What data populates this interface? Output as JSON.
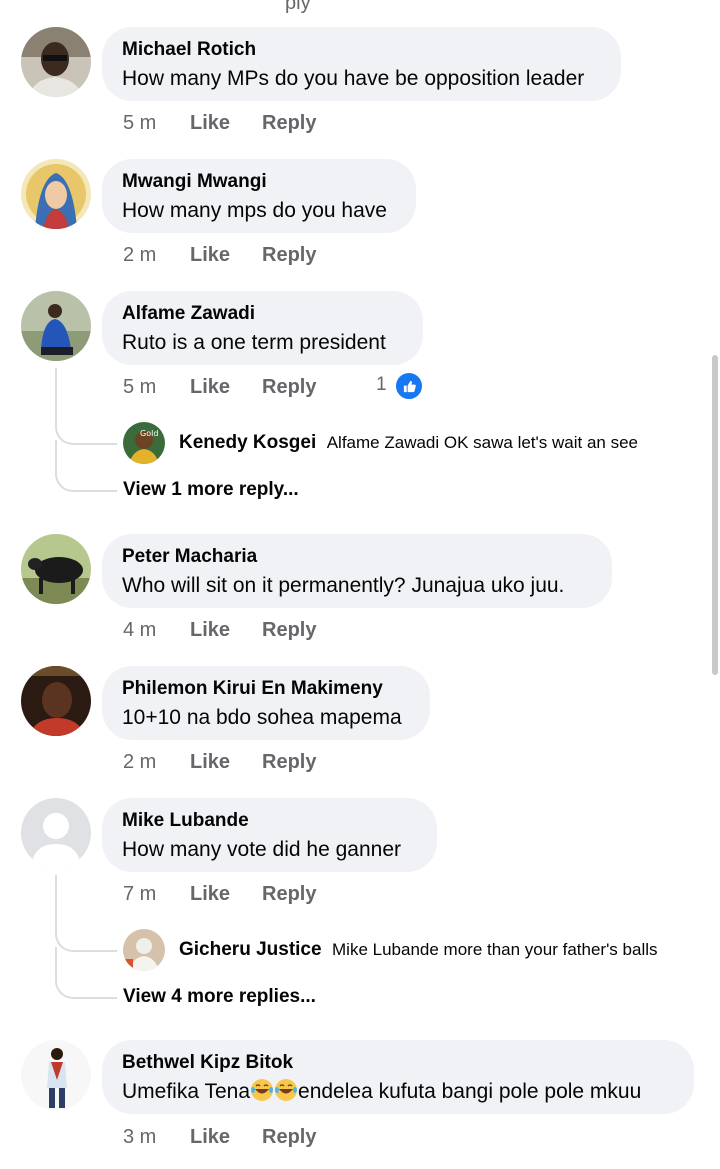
{
  "top_hint": "ply",
  "comments": [
    {
      "author": "Michael Rotich",
      "text": "How many MPs do you have be opposition leader",
      "time": "5 m",
      "like": "Like",
      "reply": "Reply"
    },
    {
      "author": "Mwangi Mwangi",
      "text": "How many mps do you have",
      "time": "2 m",
      "like": "Like",
      "reply": "Reply"
    },
    {
      "author": "Alfame Zawadi",
      "text": "Ruto is a one term president",
      "time": "5 m",
      "like": "Like",
      "reply": "Reply",
      "reaction_count": "1",
      "reply_preview": {
        "author": "Kenedy Kosgei",
        "text": "Alfame Zawadi OK sawa let's wait an see",
        "avatar_label": "Gold"
      },
      "view_more": "View 1 more reply..."
    },
    {
      "author": "Peter Macharia",
      "text": "Who will sit on it permanently? Junajua uko juu.",
      "time": "4 m",
      "like": "Like",
      "reply": "Reply"
    },
    {
      "author": "Philemon Kirui En Makimeny",
      "text": "10+10 na bdo sohea mapema",
      "time": "2 m",
      "like": "Like",
      "reply": "Reply"
    },
    {
      "author": "Mike Lubande",
      "text": "How many vote did he ganner",
      "time": "7 m",
      "like": "Like",
      "reply": "Reply",
      "reply_preview": {
        "author": "Gicheru Justice",
        "text": "Mike Lubande more than your father's balls"
      },
      "view_more": "View 4 more replies..."
    },
    {
      "author": "Bethwel Kipz Bitok",
      "text_a": "Umefika Tena",
      "text_b": "endelea kufuta bangi pole pole mkuu",
      "time": "3 m",
      "like": "Like",
      "reply": "Reply"
    }
  ],
  "colors": {
    "bubble": "#f0f2f5",
    "meta": "#65676b",
    "like_blue": "#1877f2"
  }
}
